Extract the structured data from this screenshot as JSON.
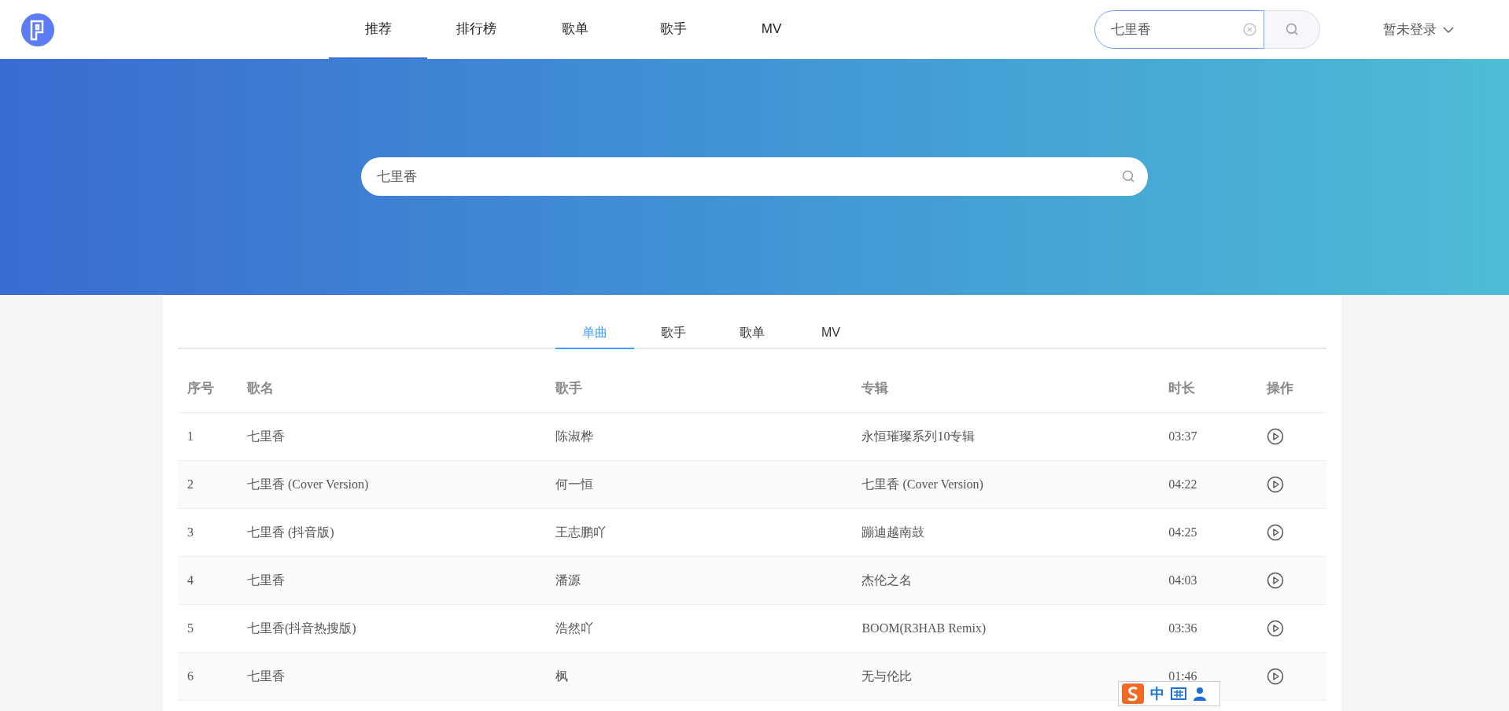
{
  "nav": [
    {
      "label": "推荐",
      "selected": true
    },
    {
      "label": "排行榜",
      "selected": false
    },
    {
      "label": "歌单",
      "selected": false
    },
    {
      "label": "歌手",
      "selected": false
    },
    {
      "label": "MV",
      "selected": false
    }
  ],
  "header_search": {
    "value": "七里香"
  },
  "login": {
    "label": "暂未登录"
  },
  "banner_search": {
    "value": "七里香"
  },
  "result_tabs": [
    {
      "label": "单曲",
      "selected": true
    },
    {
      "label": "歌手",
      "selected": false
    },
    {
      "label": "歌单",
      "selected": false
    },
    {
      "label": "MV",
      "selected": false
    }
  ],
  "table": {
    "columns": [
      "序号",
      "歌名",
      "歌手",
      "专辑",
      "时长",
      "操作"
    ],
    "rows": [
      {
        "index": "1",
        "title": "七里香",
        "artist": "陈淑桦",
        "album": "永恒璀璨系列10专辑",
        "duration": "03:37"
      },
      {
        "index": "2",
        "title": "七里香 (Cover Version)",
        "artist": "何一恒",
        "album": "七里香 (Cover Version)",
        "duration": "04:22"
      },
      {
        "index": "3",
        "title": "七里香 (抖音版)",
        "artist": "王志鹏吖",
        "album": "蹦迪越南鼓",
        "duration": "04:25"
      },
      {
        "index": "4",
        "title": "七里香",
        "artist": "潘源",
        "album": "杰伦之名",
        "duration": "04:03"
      },
      {
        "index": "5",
        "title": "七里香(抖音热搜版)",
        "artist": "浩然吖",
        "album": "BOOM(R3HAB Remix)",
        "duration": "03:36"
      },
      {
        "index": "6",
        "title": "七里香",
        "artist": "枫",
        "album": "无与伦比",
        "duration": "01:46"
      }
    ]
  },
  "ime_bar": {
    "mode": "中"
  }
}
